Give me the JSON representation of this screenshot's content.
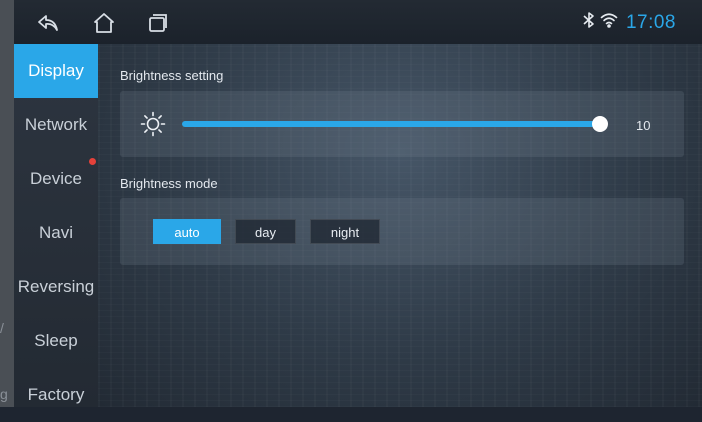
{
  "status_bar": {
    "time": "17:08",
    "icons": [
      "back-icon",
      "home-icon",
      "recent-apps-icon",
      "bluetooth-icon",
      "wifi-icon"
    ],
    "accent_color": "#2aa7e8"
  },
  "left_edge_fragments": [
    "/",
    "g"
  ],
  "sidebar": {
    "items": [
      {
        "label": "Display",
        "active": true
      },
      {
        "label": "Network"
      },
      {
        "label": "Device",
        "badge": true
      },
      {
        "label": "Navi"
      },
      {
        "label": "Reversing"
      },
      {
        "label": "Sleep"
      },
      {
        "label": "Factory"
      }
    ]
  },
  "brightness": {
    "label": "Brightness setting",
    "icon": "sun-icon",
    "value": "10",
    "level_fraction": 1.0
  },
  "brightness_mode": {
    "label": "Brightness mode",
    "options": [
      "auto",
      "day",
      "night"
    ],
    "selected": "auto"
  }
}
